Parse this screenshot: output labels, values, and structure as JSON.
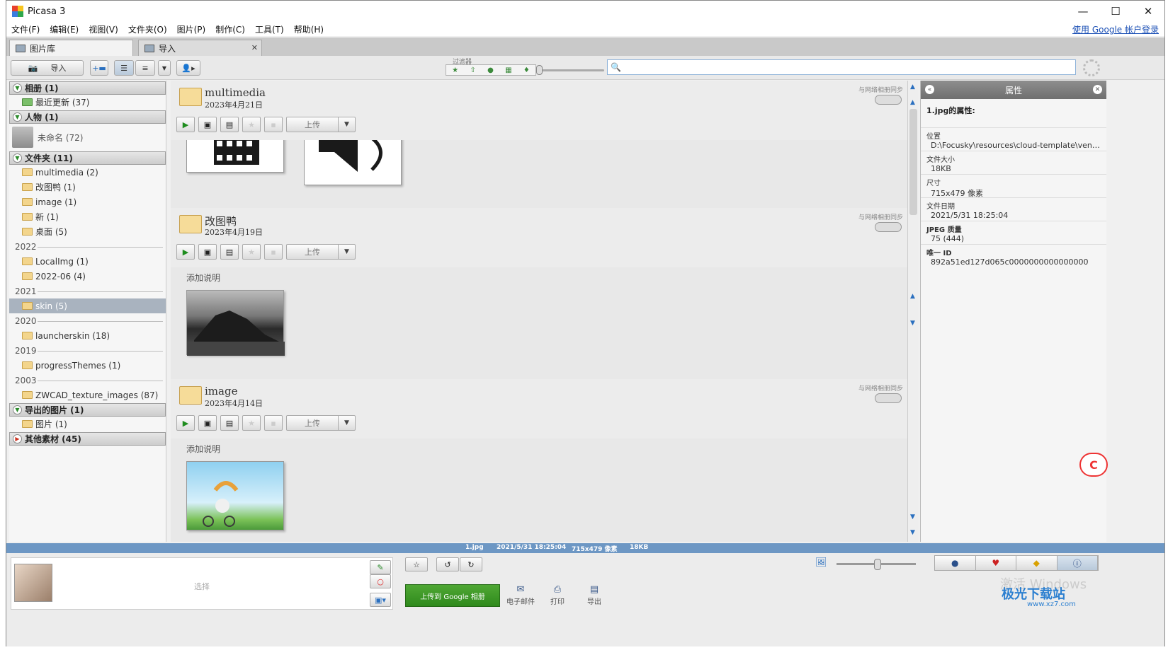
{
  "window": {
    "title": "Picasa 3",
    "min": "—",
    "max": "☐",
    "close": "✕"
  },
  "menu": [
    "文件(F)",
    "编辑(E)",
    "视图(V)",
    "文件夹(O)",
    "图片(P)",
    "制作(C)",
    "工具(T)",
    "帮助(H)"
  ],
  "login": "使用 Google 帐户登录",
  "tabs": [
    {
      "label": "图片库"
    },
    {
      "label": "导入"
    }
  ],
  "toolbar": {
    "import": "导入",
    "filter_label": "过滤器",
    "search_value": ""
  },
  "sidebar": {
    "albums": {
      "label": "相册 (1)",
      "items": [
        "最近更新 (37)"
      ]
    },
    "people": {
      "label": "人物 (1)",
      "items": [
        "未命名 (72)"
      ]
    },
    "folders": {
      "label": "文件夹 (11)"
    },
    "f_items": [
      "multimedia (2)",
      "改图鸭 (1)",
      "image (1)",
      "新 (1)",
      "桌面 (5)"
    ],
    "y2022": "2022",
    "y2022_items": [
      "LocalImg (1)",
      "2022-06 (4)"
    ],
    "y2021": "2021",
    "y2021_items": [
      "skin (5)"
    ],
    "y2020": "2020",
    "y2020_items": [
      "launcherskin (18)"
    ],
    "y2019": "2019",
    "y2019_items": [
      "progressThemes (1)"
    ],
    "y2003": "2003",
    "y2003_items": [
      "ZWCAD_texture_images (87)"
    ],
    "exported": {
      "label": "导出的图片 (1)",
      "items": [
        "图片 (1)"
      ]
    },
    "other": {
      "label": "其他素材 (45)"
    }
  },
  "folders": [
    {
      "name": "multimedia",
      "date": "2023年4月21日",
      "sync": "与网络相册同步",
      "upload": "上传"
    },
    {
      "name": "改图鸭",
      "date": "2023年4月19日",
      "sync": "与网络相册同步",
      "upload": "上传",
      "caption": "添加说明"
    },
    {
      "name": "image",
      "date": "2023年4月14日",
      "sync": "与网络相册同步",
      "upload": "上传",
      "caption": "添加说明"
    }
  ],
  "properties": {
    "title": "属性",
    "subtitle": "1.jpg的属性:",
    "rows": [
      {
        "k": "位置",
        "v": "D:\\Focusky\\resources\\cloud-template\\vendor..."
      },
      {
        "k": "文件大小",
        "v": "18KB"
      },
      {
        "k": "尺寸",
        "v": "715x479 像素"
      },
      {
        "k": "文件日期",
        "v": "2021/5/31 18:25:04"
      },
      {
        "k": "JPEG 质量",
        "v": "75 (444)"
      },
      {
        "k": "唯一 ID",
        "v": "892a51ed127d065c0000000000000000"
      }
    ]
  },
  "status": {
    "file": "1.jpg",
    "date": "2021/5/31 18:25:04",
    "dims": "715x479 像素",
    "size": "18KB"
  },
  "bottom": {
    "select": "选择",
    "upload_google": "上传到 Google 相册",
    "email": "电子邮件",
    "print": "打印",
    "export": "导出"
  },
  "watermark": {
    "activate": "激活 Windows",
    "site": "极光下载站",
    "url": "www.xz7.com"
  },
  "colors": {
    "accent": "#6d97c4",
    "green": "#2f8a1c"
  }
}
